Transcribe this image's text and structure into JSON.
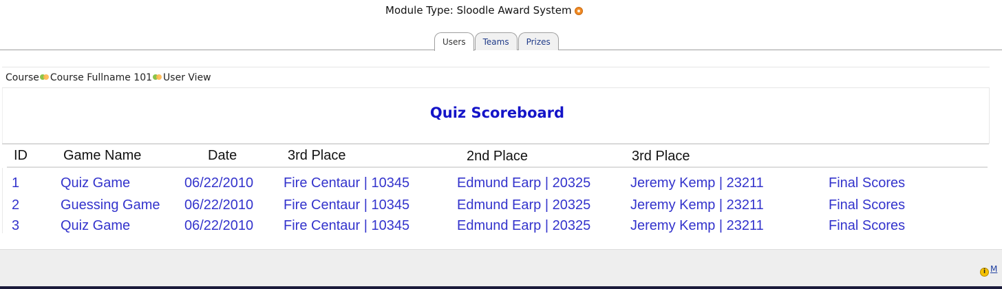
{
  "header": {
    "module_type_label": "Module Type: Sloodle Award System",
    "help_icon": "help-icon"
  },
  "tabs": [
    {
      "label": "Users",
      "active": true
    },
    {
      "label": "Teams",
      "active": false
    },
    {
      "label": "Prizes",
      "active": false
    }
  ],
  "breadcrumb": {
    "items": [
      "Course",
      "Course Fullname 101",
      "User View"
    ],
    "separator_icon": "breadcrumb-separator-icon"
  },
  "scoreboard": {
    "title": "Quiz Scoreboard",
    "columns": [
      "ID",
      "Game Name",
      "Date",
      "3rd Place",
      "2nd Place",
      "3rd Place"
    ],
    "rows": [
      {
        "id": "1",
        "game_name": "Quiz Game",
        "date": "06/22/2010",
        "place_a": "Fire Centaur | 10345",
        "place_b": "Edmund Earp | 20325",
        "place_c": "Jeremy Kemp | 23211",
        "action": "Final Scores"
      },
      {
        "id": "2",
        "game_name": "Guessing Game",
        "date": "06/22/2010",
        "place_a": "Fire Centaur | 10345",
        "place_b": "Edmund Earp | 20325",
        "place_c": "Jeremy Kemp | 23211",
        "action": "Final Scores"
      },
      {
        "id": "3",
        "game_name": "Quiz Game",
        "date": "06/22/2010",
        "place_a": "Fire Centaur | 10345",
        "place_b": "Edmund Earp | 20325",
        "place_c": "Jeremy Kemp | 23211",
        "action": "Final Scores"
      }
    ]
  },
  "footer": {
    "link_text": "M",
    "info_icon": "info-icon"
  },
  "colors": {
    "link": "#3333cc",
    "title": "#1414c8",
    "footer_bg": "#eeeeee"
  }
}
